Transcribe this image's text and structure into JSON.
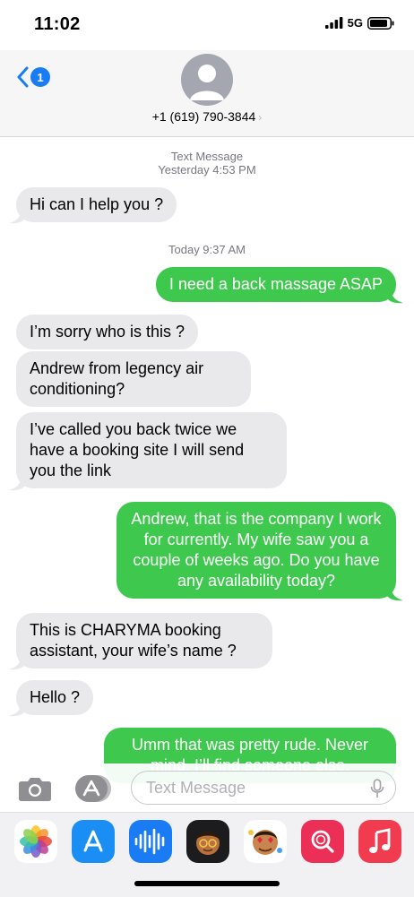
{
  "status_bar": {
    "time": "11:02",
    "network": "5G"
  },
  "header": {
    "back_badge": "1",
    "contact": "+1 (619) 790-3844"
  },
  "thread": {
    "meta1_line1": "Text Message",
    "meta1_line2": "Yesterday 4:53 PM",
    "meta2": "Today 9:37 AM",
    "messages": [
      {
        "from": "them",
        "text": "Hi can I help you ?"
      },
      {
        "from": "me",
        "text": "I need a back massage ASAP"
      },
      {
        "from": "them",
        "text": "I’m sorry who is this ?"
      },
      {
        "from": "them",
        "text": "Andrew from legency air conditioning?"
      },
      {
        "from": "them",
        "text": "I’ve called you back twice we have a booking site I will send you the link"
      },
      {
        "from": "me",
        "text": "Andrew, that is the company I work for currently. My wife saw you a couple of weeks ago. Do you have any availability today?"
      },
      {
        "from": "them",
        "text": "This is CHARYMA booking assistant, your wife’s name ?"
      },
      {
        "from": "them",
        "text": "Hello ?"
      },
      {
        "from": "me",
        "text": "Umm that was pretty rude. Never mind. I’ll find someone else."
      }
    ]
  },
  "composer": {
    "placeholder": "Text Message"
  },
  "colors": {
    "sms_green": "#3ec94e",
    "incoming_gray": "#e9e9eb",
    "ios_blue": "#1a7cf5"
  },
  "app_drawer": [
    "photos-icon",
    "app-store-icon",
    "audio-message-icon",
    "memoji-icon",
    "memoji-stickers-icon",
    "search-images-icon",
    "music-icon"
  ]
}
